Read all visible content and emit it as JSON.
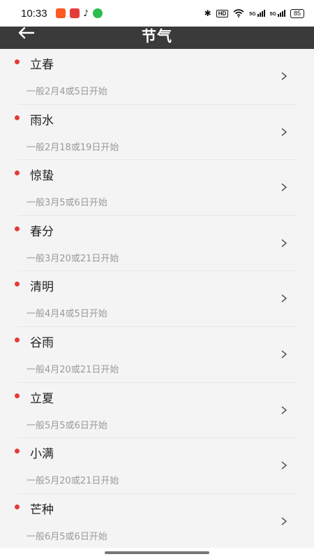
{
  "status_bar": {
    "time": "10:33",
    "notifications": [
      {
        "icon": "app-badge-icon",
        "color": "#ff5a1f"
      },
      {
        "icon": "app-news-icon",
        "color": "#e63b3b"
      },
      {
        "icon": "tiktok-icon",
        "color": "#111111"
      },
      {
        "icon": "wechat-icon",
        "color": "#2bbd4f"
      }
    ],
    "hd_label": "HD",
    "signal1_label": "5G",
    "signal2_label": "5G",
    "battery": "85"
  },
  "header": {
    "title": "节气",
    "back_icon": "arrow-left-icon",
    "background": "#3a3a3a"
  },
  "accent_color": "#e23b3b",
  "terms": [
    {
      "name": "立春",
      "desc": "一般2月4或5日开始"
    },
    {
      "name": "雨水",
      "desc": "一般2月18或19日开始"
    },
    {
      "name": "惊蛰",
      "desc": "一般3月5或6日开始"
    },
    {
      "name": "春分",
      "desc": "一般3月20或21日开始"
    },
    {
      "name": "清明",
      "desc": "一般4月4或5日开始"
    },
    {
      "name": "谷雨",
      "desc": "一般4月20或21日开始"
    },
    {
      "name": "立夏",
      "desc": "一般5月5或6日开始"
    },
    {
      "name": "小满",
      "desc": "一般5月20或21日开始"
    },
    {
      "name": "芒种",
      "desc": "一般6月5或6日开始"
    }
  ]
}
